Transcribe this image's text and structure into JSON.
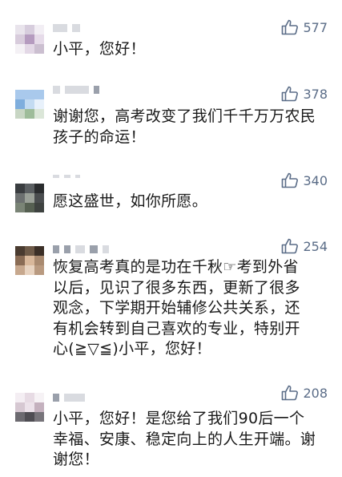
{
  "comments": [
    {
      "likes": "577",
      "text": "小平，您好！"
    },
    {
      "likes": "378",
      "text": "谢谢您，高考改变了我们千千万万农民孩子的命运！"
    },
    {
      "likes": "340",
      "text": "愿这盛世，如你所愿。"
    },
    {
      "likes": "254",
      "text": "恢复高考真的是功在千秋☞考到外省以后，见识了很多东西，更新了很多观念，下学期开始辅修公共关系，还有机会转到自己喜欢的专业，特别开心(≧▽≦)小平，您好！"
    },
    {
      "likes": "208",
      "text": "小平，您好！是您给了我们90后一个幸福、安康、稳定向上的人生开端。谢谢您！"
    }
  ],
  "colors": {
    "like": "#5a6c87",
    "text": "#1a1a1a",
    "placeholder": "#d9dbe0"
  },
  "icons": {
    "like": "thumbs-up-icon"
  }
}
